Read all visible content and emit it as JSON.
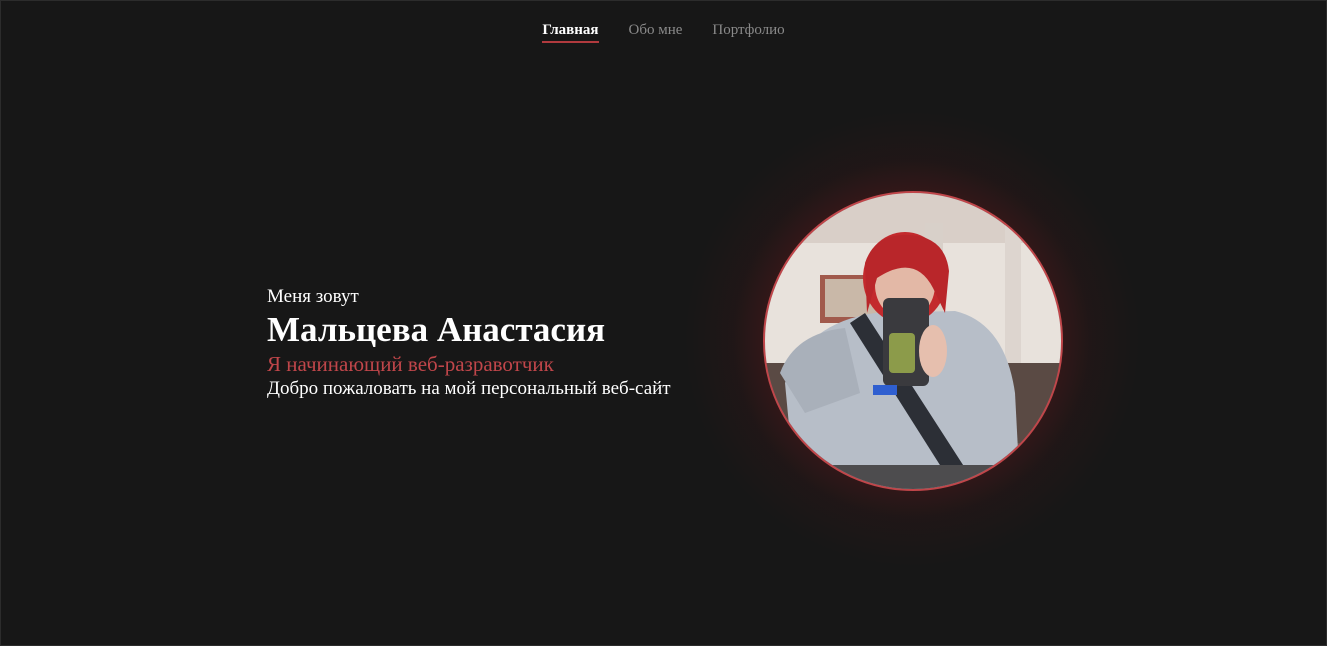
{
  "nav": {
    "items": [
      {
        "label": "Главная",
        "active": true
      },
      {
        "label": "Обо мне",
        "active": false
      },
      {
        "label": "Портфолио",
        "active": false
      }
    ]
  },
  "hero": {
    "greeting": "Меня зовут",
    "name": "Мальцева Анастасия",
    "role": "Я начинающий веб-разравотчик",
    "welcome": "Добро пожаловать на мой персональный веб-сайт"
  },
  "avatar": {
    "icon": "profile-photo"
  },
  "colors": {
    "background": "#171717",
    "accent": "#c0464a",
    "text": "#ffffff",
    "nav_inactive": "#8a8a8a"
  }
}
